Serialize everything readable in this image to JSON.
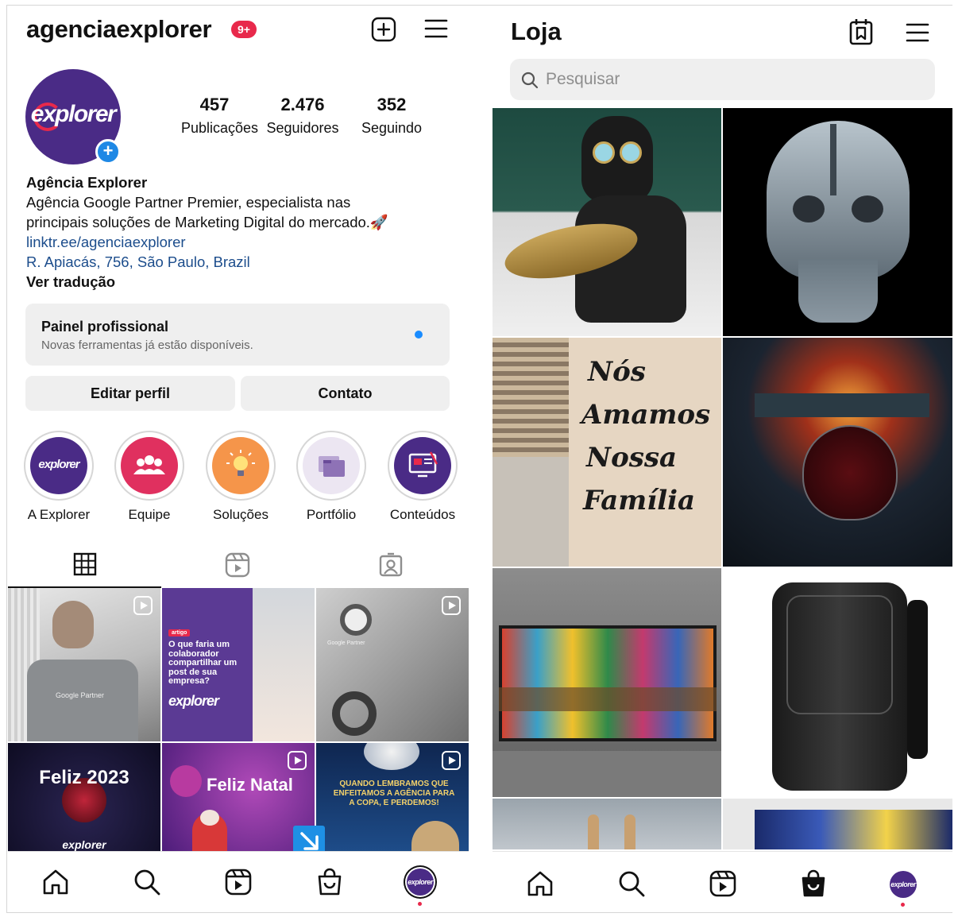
{
  "profile": {
    "username": "agenciaexplorer",
    "notification_badge": "9+",
    "avatar_logo_text": "explorer",
    "stats": [
      {
        "value": "457",
        "label": "Publicações"
      },
      {
        "value": "2.476",
        "label": "Seguidores"
      },
      {
        "value": "352",
        "label": "Seguindo"
      }
    ],
    "display_name": "Agência Explorer",
    "bio_line1": "Agência Google Partner Premier, especialista nas",
    "bio_line2": "principais soluções de Marketing Digital do mercado.🚀",
    "link": "linktr.ee/agenciaexplorer",
    "address": "R. Apiacás, 756, São Paulo, Brazil",
    "translate": "Ver tradução"
  },
  "pro_panel": {
    "title": "Painel profissional",
    "subtitle": "Novas ferramentas já estão disponíveis."
  },
  "buttons": {
    "edit_profile": "Editar perfil",
    "contact": "Contato"
  },
  "highlights": [
    {
      "label": "A Explorer",
      "icon": "explorer-logo",
      "color": "#4a2b86"
    },
    {
      "label": "Equipe",
      "icon": "people-icon",
      "color": "#e0305f"
    },
    {
      "label": "Soluções",
      "icon": "lightbulb-icon",
      "color": "#f5954a"
    },
    {
      "label": "Portfólio",
      "icon": "folders-icon",
      "color": "#ece6f2"
    },
    {
      "label": "Conteúdos",
      "icon": "monitor-icon",
      "color": "#4a2b86"
    }
  ],
  "posts": [
    {
      "caption": "Google Partner"
    },
    {
      "tag": "artigo",
      "caption": "O que faria um colaborador compartilhar um post de sua empresa?",
      "brand": "explorer"
    },
    {
      "caption": "Google Partner"
    },
    {
      "caption": "Feliz 2023",
      "brand": "explorer"
    },
    {
      "caption": "Feliz Natal"
    },
    {
      "caption": "QUANDO LEMBRAMOS QUE ENFEITAMOS A AGÊNCIA PARA A COPA, E PERDEMOS!"
    }
  ],
  "shop": {
    "title": "Loja",
    "search_placeholder": "Pesquisar",
    "wall_text": [
      "Nós",
      "Amamos",
      "Nossa",
      "Família"
    ]
  },
  "nav": {
    "avatar_text": "explorer"
  },
  "colors": {
    "brand_purple": "#4a2b86",
    "brand_red": "#e8294b",
    "link_blue": "#1c4d8c",
    "accent_blue": "#1a8cff"
  }
}
